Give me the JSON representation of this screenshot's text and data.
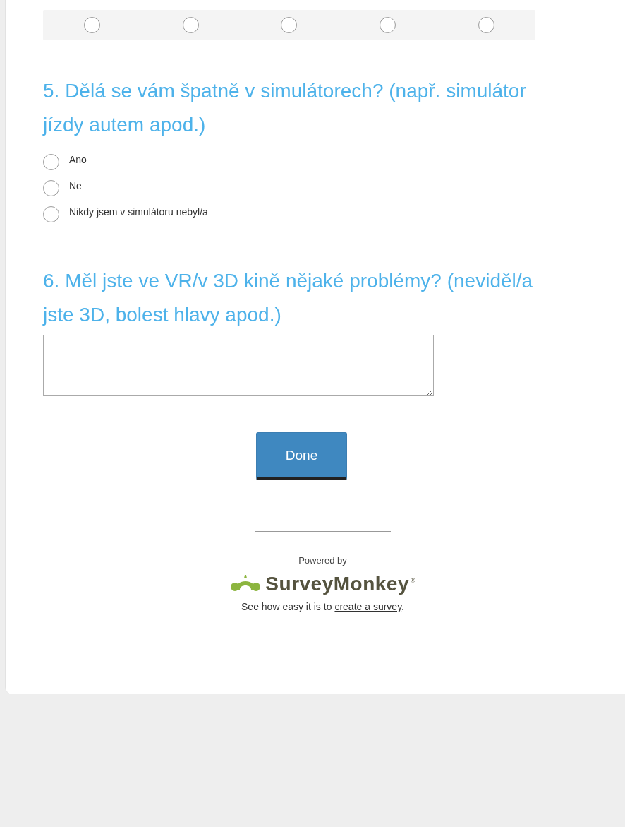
{
  "matrix_row": {
    "options": [
      {
        "selected": false
      },
      {
        "selected": false
      },
      {
        "selected": false
      },
      {
        "selected": false
      },
      {
        "selected": false
      }
    ]
  },
  "questions": [
    {
      "kind": "radio",
      "title": "5. Dělá se vám špatně v simulátorech? (např. simulátor jízdy autem apod.)",
      "options": [
        {
          "label": "Ano",
          "selected": false
        },
        {
          "label": "Ne",
          "selected": false
        },
        {
          "label": "Nikdy jsem v simulátoru nebyl/a",
          "selected": false
        }
      ]
    },
    {
      "kind": "text",
      "title": "6. Měl jste ve VR/v 3D kině nějaké problémy? (neviděl/a jste 3D, bolest hlavy apod.)"
    }
  ],
  "done_button": "Done",
  "footer": {
    "powered_by": "Powered by",
    "logo_text": "SurveyMonkey",
    "logo_mark": "®",
    "note": "See how easy it is to",
    "link": "create a survey",
    "note_end": "."
  }
}
